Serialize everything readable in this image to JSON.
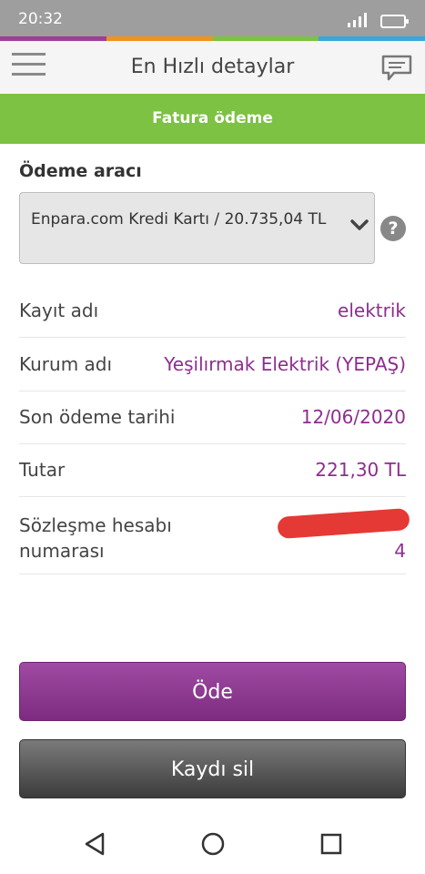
{
  "status_bar": {
    "time": "20:32"
  },
  "color_strip": [
    "#9c3f98",
    "#f0931e",
    "#7dc242",
    "#3aa6dd"
  ],
  "app_bar": {
    "title": "En Hızlı detaylar"
  },
  "section_bar": {
    "title": "Fatura ödeme"
  },
  "payment_tool": {
    "label": "Ödeme aracı",
    "selected": "Enpara.com Kredi Kartı / 20.735,04 TL"
  },
  "details": [
    {
      "key": "Kayıt adı",
      "value": "elektrik"
    },
    {
      "key": "Kurum adı",
      "value": "Yeşilırmak Elektrik (YEPAŞ)"
    },
    {
      "key": "Son ödeme tarihi",
      "value": "12/06/2020"
    },
    {
      "key": "Tutar",
      "value": "221,30 TL"
    }
  ],
  "contract": {
    "key": "Sözleşme hesabı numarası",
    "value_visible": "4"
  },
  "buttons": {
    "pay": "Öde",
    "delete": "Kaydı sil"
  },
  "accent_colors": {
    "green": "#7dc242",
    "purple": "#8e2d8f",
    "redaction": "#e53935"
  }
}
